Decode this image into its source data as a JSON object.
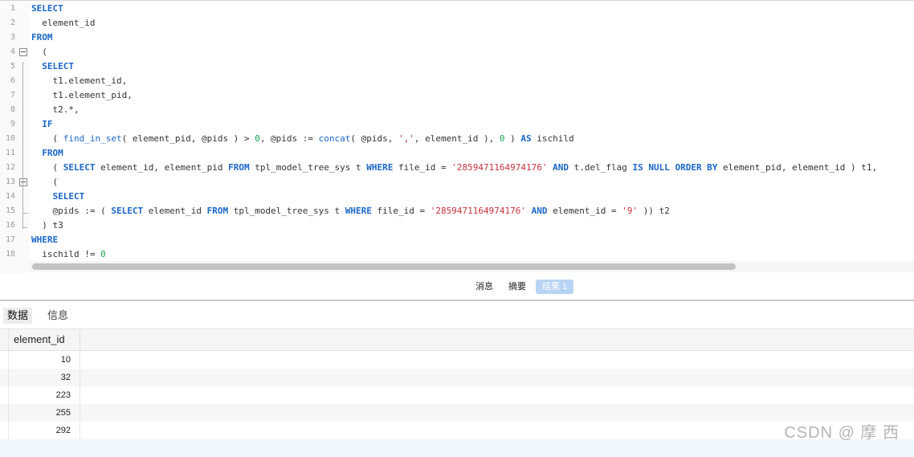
{
  "editor": {
    "lines": [
      {
        "n": "1",
        "parts": [
          [
            "kw",
            "SELECT"
          ]
        ]
      },
      {
        "n": "2",
        "parts": [
          [
            "",
            "  element_id"
          ]
        ]
      },
      {
        "n": "3",
        "parts": [
          [
            "kw",
            "FROM"
          ]
        ]
      },
      {
        "n": "4",
        "parts": [
          [
            "",
            "  ("
          ]
        ]
      },
      {
        "n": "5",
        "parts": [
          [
            "",
            "  "
          ],
          [
            "kw",
            "SELECT"
          ]
        ]
      },
      {
        "n": "6",
        "parts": [
          [
            "",
            "    t1.element_id,"
          ]
        ]
      },
      {
        "n": "7",
        "parts": [
          [
            "",
            "    t1.element_pid,"
          ]
        ]
      },
      {
        "n": "8",
        "parts": [
          [
            "",
            "    t2.*,"
          ]
        ]
      },
      {
        "n": "9",
        "parts": [
          [
            "",
            "  "
          ],
          [
            "kw",
            "IF"
          ]
        ]
      },
      {
        "n": "10",
        "parts": [
          [
            "",
            "    ( "
          ],
          [
            "fn",
            "find_in_set"
          ],
          [
            "",
            "( element_pid, @pids ) > "
          ],
          [
            "num",
            "0"
          ],
          [
            "",
            ", @pids := "
          ],
          [
            "fn",
            "concat"
          ],
          [
            "",
            "( @pids, "
          ],
          [
            "str",
            "','"
          ],
          [
            "",
            ", element_id ), "
          ],
          [
            "num",
            "0"
          ],
          [
            "",
            " ) "
          ],
          [
            "kw",
            "AS"
          ],
          [
            "",
            " ischild"
          ]
        ]
      },
      {
        "n": "11",
        "parts": [
          [
            "",
            "  "
          ],
          [
            "kw",
            "FROM"
          ]
        ]
      },
      {
        "n": "12",
        "parts": [
          [
            "",
            "    ( "
          ],
          [
            "kw",
            "SELECT"
          ],
          [
            "",
            " element_id, element_pid "
          ],
          [
            "kw",
            "FROM"
          ],
          [
            "",
            " tpl_model_tree_sys t "
          ],
          [
            "kw",
            "WHERE"
          ],
          [
            "",
            " file_id = "
          ],
          [
            "str",
            "'2859471164974176'"
          ],
          [
            "",
            " "
          ],
          [
            "kw",
            "AND"
          ],
          [
            "",
            " t.del_flag "
          ],
          [
            "kw",
            "IS NULL ORDER BY"
          ],
          [
            "",
            " element_pid, element_id ) t1,"
          ]
        ]
      },
      {
        "n": "13",
        "parts": [
          [
            "",
            "    ("
          ]
        ]
      },
      {
        "n": "14",
        "parts": [
          [
            "",
            "    "
          ],
          [
            "kw",
            "SELECT"
          ]
        ]
      },
      {
        "n": "15",
        "parts": [
          [
            "",
            "    @pids := ( "
          ],
          [
            "kw",
            "SELECT"
          ],
          [
            "",
            " element_id "
          ],
          [
            "kw",
            "FROM"
          ],
          [
            "",
            " tpl_model_tree_sys t "
          ],
          [
            "kw",
            "WHERE"
          ],
          [
            "",
            " file_id = "
          ],
          [
            "str",
            "'2859471164974176'"
          ],
          [
            "",
            " "
          ],
          [
            "kw",
            "AND"
          ],
          [
            "",
            " element_id = "
          ],
          [
            "str",
            "'9'"
          ],
          [
            "",
            " )) t2"
          ]
        ]
      },
      {
        "n": "16",
        "parts": [
          [
            "",
            "  ) t3"
          ]
        ]
      },
      {
        "n": "17",
        "parts": [
          [
            "kw",
            "WHERE"
          ]
        ]
      },
      {
        "n": "18",
        "parts": [
          [
            "",
            "  ischild != "
          ],
          [
            "num",
            "0"
          ]
        ]
      }
    ]
  },
  "result_tabs": {
    "messages": "消息",
    "summary": "摘要",
    "result1": "结果 1"
  },
  "sub_tabs": {
    "data": "数据",
    "info": "信息"
  },
  "grid": {
    "column": "element_id",
    "rows": [
      "10",
      "32",
      "223",
      "255",
      "292"
    ]
  },
  "watermark": "CSDN @  摩 西"
}
